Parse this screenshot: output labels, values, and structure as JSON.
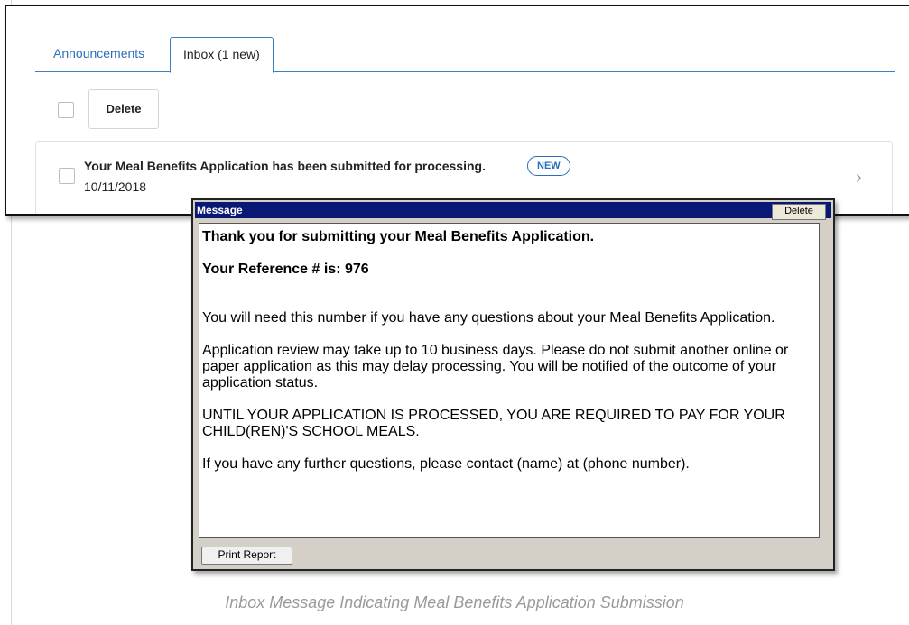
{
  "tabs": [
    {
      "label": "Announcements"
    },
    {
      "label": "Inbox (1 new)"
    }
  ],
  "toolbar": {
    "delete_label": "Delete"
  },
  "message_row": {
    "subject": "Your Meal Benefits Application has been submitted for processing.",
    "badge": "NEW",
    "date": "10/11/2018"
  },
  "dialog": {
    "title": "Message",
    "delete_label": "Delete",
    "heading": "Thank you for submitting your Meal Benefits Application.",
    "reference": "Your Reference # is: 976",
    "para1": "You will need this number if you have any questions about your Meal Benefits Application.",
    "para2": "Application review may take up to 10 business days.  Please do not submit another online or paper application as this may delay processing.  You will be notified of the outcome of your application status.",
    "para3": "UNTIL YOUR APPLICATION IS PROCESSED, YOU ARE REQUIRED TO PAY FOR YOUR CHILD(REN)'S SCHOOL MEALS.",
    "para4": "If you have any further questions, please contact (name) at (phone number).",
    "print_label": "Print Report"
  },
  "caption": "Inbox Message Indicating Meal Benefits Application Submission",
  "colors": {
    "accent": "#2a6ebb",
    "titlebar": "#0a1875"
  }
}
